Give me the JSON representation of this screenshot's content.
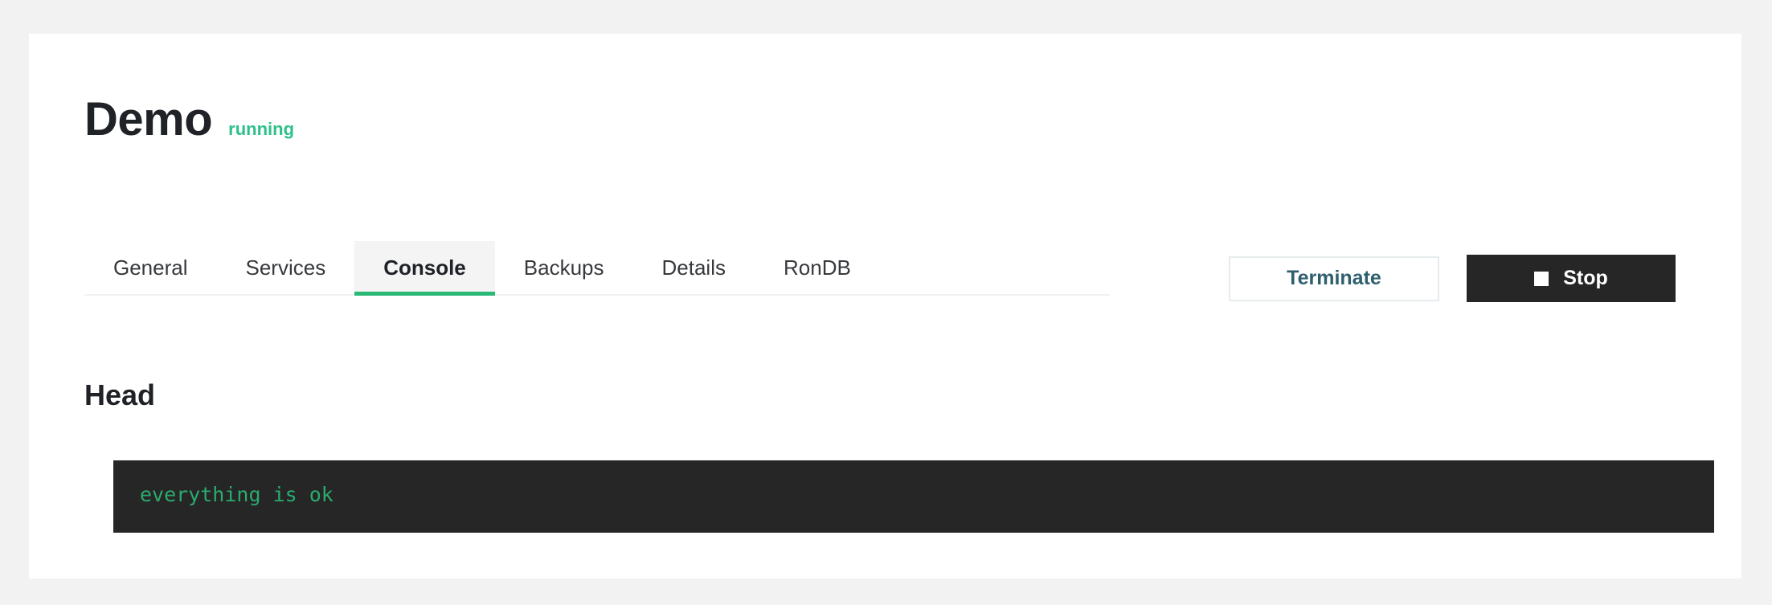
{
  "page": {
    "background_color": "#f2f2f2",
    "card_background": "#ffffff"
  },
  "header": {
    "title": "Demo",
    "status": "running",
    "status_color": "#2ec08a"
  },
  "tabs": [
    {
      "label": "General",
      "active": false
    },
    {
      "label": "Services",
      "active": false
    },
    {
      "label": "Console",
      "active": true
    },
    {
      "label": "Backups",
      "active": false
    },
    {
      "label": "Details",
      "active": false
    },
    {
      "label": "RonDB",
      "active": false
    }
  ],
  "tab_accent_color": "#2ab877",
  "actions": {
    "terminate_label": "Terminate",
    "stop_label": "Stop",
    "stop_icon": "stop-square-icon"
  },
  "console_section": {
    "heading": "Head",
    "lines": [
      "everything is ok"
    ],
    "text_color": "#2aab6e",
    "background_color": "#262626"
  }
}
